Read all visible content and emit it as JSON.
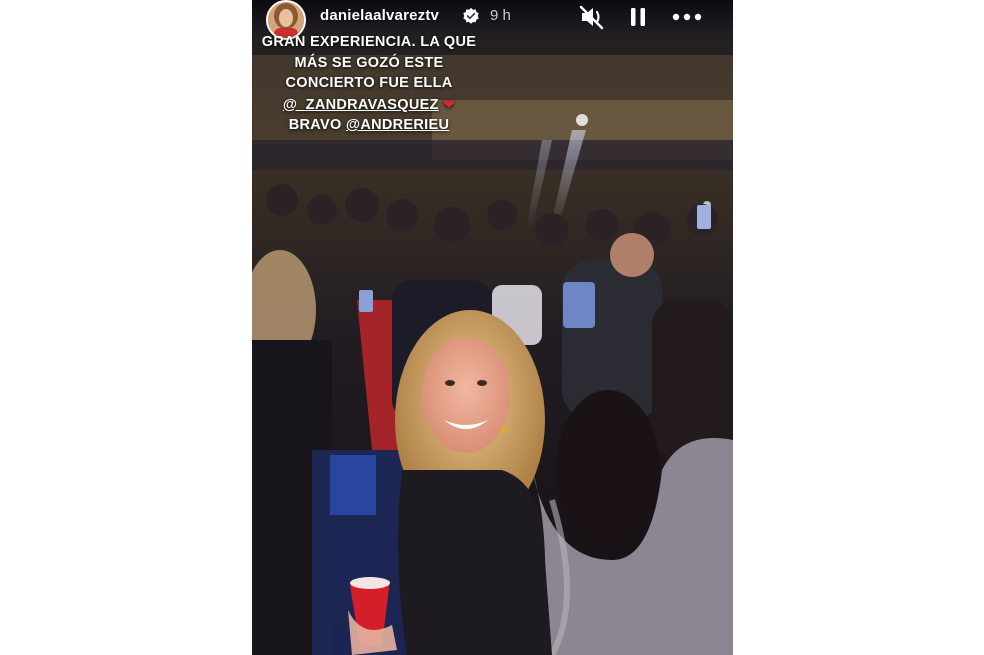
{
  "story": {
    "username": "danielaalvareztv",
    "timestamp": "9 h",
    "controls": {
      "mute_icon": "speaker-muted-icon",
      "pause_icon": "pause-icon",
      "more_icon": "more-options-icon"
    },
    "caption": {
      "line1": "GRAN EXPERIENCIA. LA QUE",
      "line2": "MÁS SE GOZÓ ESTE",
      "line3": "CONCIERTO FUE ELLA",
      "mention1": "@_ZANDRAVASQUEZ",
      "heart": "❤",
      "line5_prefix": "BRAVO ",
      "mention2": "@ANDRERIEU"
    }
  },
  "colors": {
    "page_background": "#ffffff",
    "accent_heart": "#e0242f",
    "verified_badge": "#ffffff",
    "text": "#ffffff"
  }
}
